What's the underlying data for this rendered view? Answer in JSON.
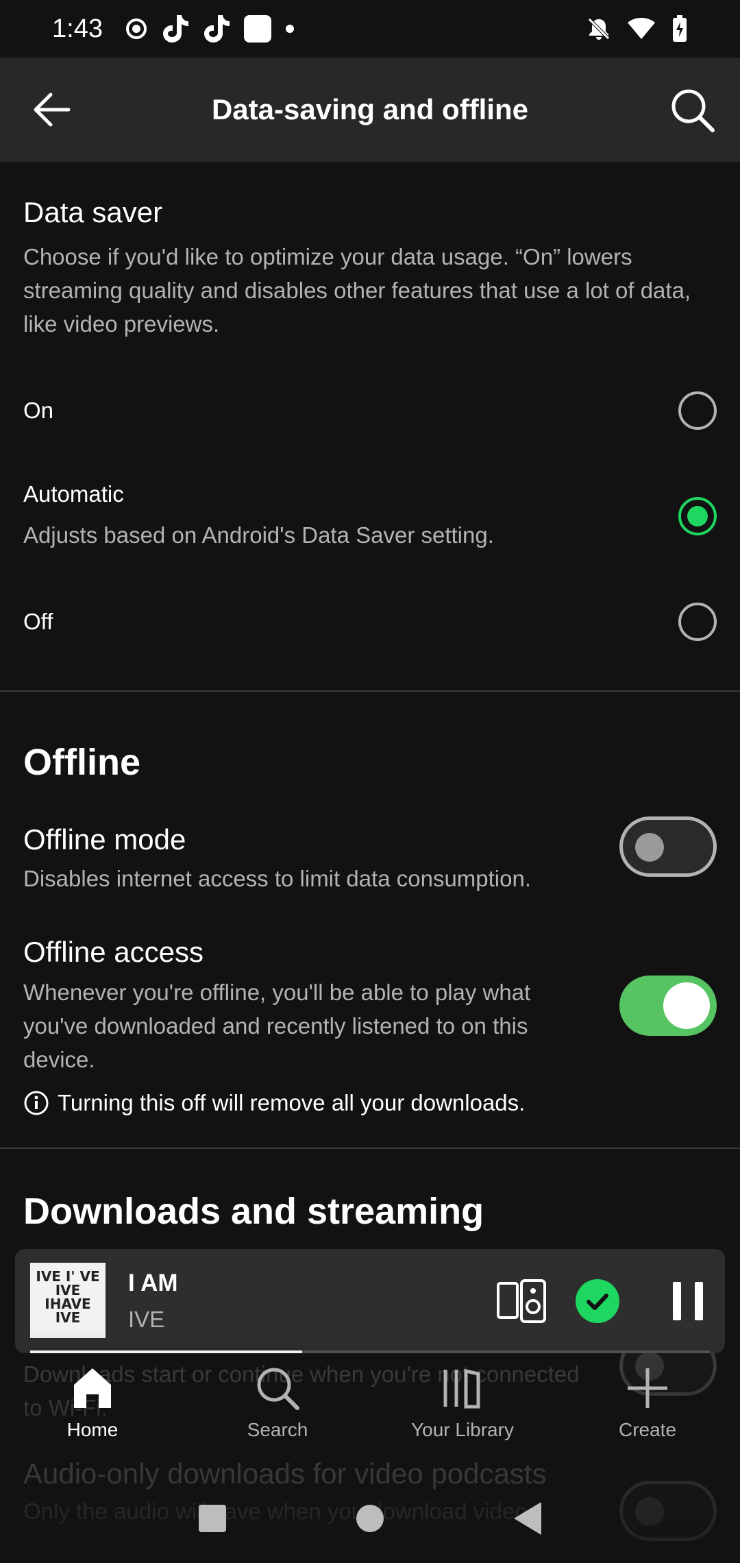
{
  "status_bar": {
    "time": "1:43"
  },
  "app_bar": {
    "title": "Data-saving and offline"
  },
  "data_saver": {
    "title": "Data saver",
    "description": "Choose if you'd like to optimize your data usage. “On” lowers streaming quality and disables other features that use a lot of data, like video previews.",
    "options": [
      {
        "label": "On",
        "sublabel": "",
        "selected": false
      },
      {
        "label": "Automatic",
        "sublabel": "Adjusts based on Android's Data Saver setting.",
        "selected": true
      },
      {
        "label": "Off",
        "sublabel": "",
        "selected": false
      }
    ]
  },
  "offline": {
    "section_title": "Offline",
    "offline_mode": {
      "title": "Offline mode",
      "description": "Disables internet access to limit data consumption.",
      "enabled": false
    },
    "offline_access": {
      "title": "Offline access",
      "description": "Whenever you're offline, you'll be able to play what you've downloaded and recently listened to on this device.",
      "enabled": true,
      "info": "Turning this off will remove all your downloads."
    }
  },
  "downloads": {
    "section_title": "Downloads and streaming",
    "cellular_description": "Downloads start or continue when you're not connected to Wi-Fi.",
    "audio_only_title": "Audio-only downloads for video podcasts",
    "audio_only_description": "Only the audio will save when you download video"
  },
  "player": {
    "song": "I AM",
    "artist": "IVE",
    "cover_text": "IVE I' VE IVE IHAVE IVE",
    "progress": 0.4
  },
  "nav": {
    "home": "Home",
    "search": "Search",
    "library": "Your Library",
    "create": "Create"
  },
  "colors": {
    "accent": "#1ed760",
    "toggle_on": "#57c463",
    "background": "#121212",
    "app_bar": "#282828"
  }
}
